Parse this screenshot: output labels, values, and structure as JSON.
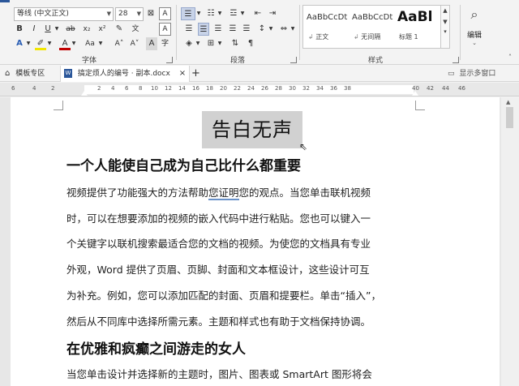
{
  "ribbon": {
    "font_name": "等线 (中文正文)",
    "font_size": "28",
    "row2": {
      "bold": "B",
      "italic": "I",
      "underline": "U",
      "strike": "ab",
      "sub": "x₂",
      "sup": "x²"
    },
    "row3": {
      "font_color_a": "A",
      "aa": "Aa",
      "grow": "A˄",
      "shrink": "A˅"
    },
    "font_group_label": "字体",
    "paragraph_group_label": "段落",
    "styles_group_label": "样式",
    "editing_label": "编辑",
    "styles": [
      {
        "sample": "AaBbCcDt",
        "name": "正文"
      },
      {
        "sample": "AaBbCcDt",
        "name": "无间隔"
      },
      {
        "sample": "AaBl",
        "name": "标题 1"
      }
    ]
  },
  "tabs": {
    "templates": "模板专区",
    "document": "搞定烦人的编号 · 副本.docx",
    "close": "×",
    "add": "+",
    "multi_window": "显示多窗口"
  },
  "ruler_numbers": [
    "6",
    "4",
    "2",
    "2",
    "4",
    "6",
    "8",
    "10",
    "12",
    "14",
    "16",
    "18",
    "20",
    "22",
    "24",
    "26",
    "28",
    "30",
    "32",
    "34",
    "36",
    "38",
    "40",
    "42",
    "44",
    "46"
  ],
  "document": {
    "title": "告白无声",
    "heading1": "一个人能使自己成为自己比什么都重要",
    "para1": [
      {
        "pre": "视频提供了功能强大的方法帮助",
        "under": "您证明",
        "post": "您的观点。当您单击联机视频"
      },
      {
        "pre": "时，可以在想要添加的视频的嵌入代码中进行粘贴。您也可以键入一",
        "under": "",
        "post": ""
      },
      {
        "pre": "个关键字以联机搜索最适合您的文档的视频。为使您的文档具有专业",
        "under": "",
        "post": ""
      },
      {
        "pre": "外观，Word 提供了页眉、页脚、封面和文本框设计，这些设计可互",
        "under": "",
        "post": ""
      },
      {
        "pre": "为补充。例如，您可以添加匹配的封面、页眉和提要栏。单击“插入”，",
        "under": "",
        "post": ""
      },
      {
        "pre": "然后从不同库中选择所需元素。主题和样式也有助于文档保持协调。",
        "under": "",
        "post": ""
      }
    ],
    "heading2": "在优雅和疯癫之间游走的女人",
    "para2_line1": "当您单击设计并选择新的主题时，图片、图表或 SmartArt 图形将会"
  }
}
